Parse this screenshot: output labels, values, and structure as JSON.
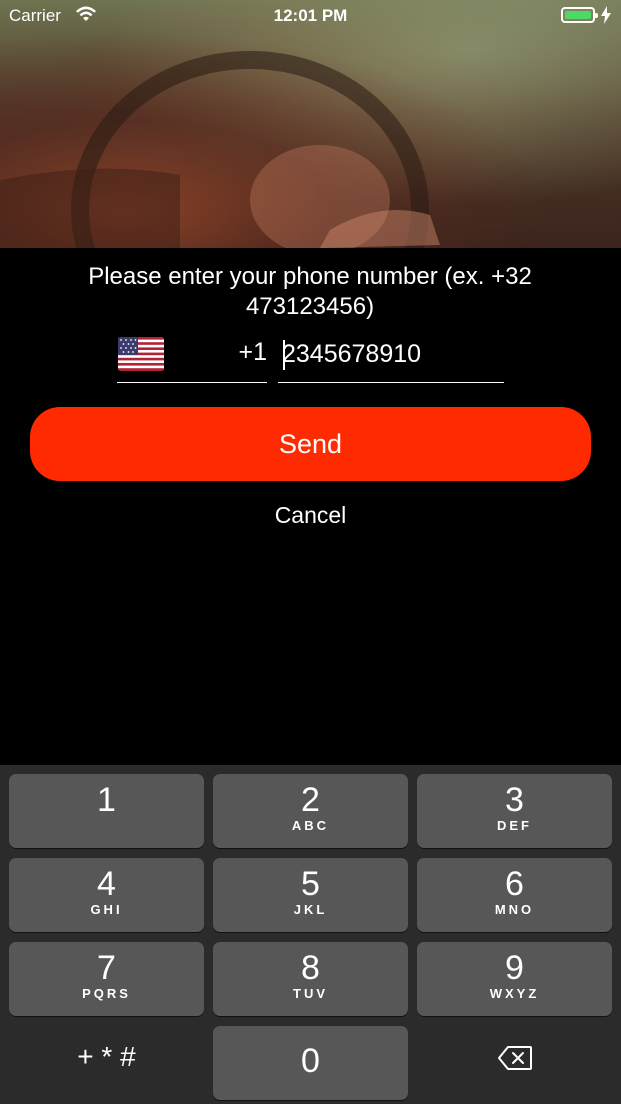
{
  "status_bar": {
    "carrier": "Carrier",
    "time": "12:01 PM"
  },
  "form": {
    "prompt": "Please enter your phone number (ex. +32 473123456)",
    "country_flag": "us-flag-icon",
    "dial_code": "+1",
    "phone_value": "2345678910",
    "send_label": "Send",
    "cancel_label": "Cancel"
  },
  "keypad": {
    "keys": [
      {
        "digit": "1",
        "letters": ""
      },
      {
        "digit": "2",
        "letters": "ABC"
      },
      {
        "digit": "3",
        "letters": "DEF"
      },
      {
        "digit": "4",
        "letters": "GHI"
      },
      {
        "digit": "5",
        "letters": "JKL"
      },
      {
        "digit": "6",
        "letters": "MNO"
      },
      {
        "digit": "7",
        "letters": "PQRS"
      },
      {
        "digit": "8",
        "letters": "TUV"
      },
      {
        "digit": "9",
        "letters": "WXYZ"
      },
      {
        "digit": "0",
        "letters": ""
      }
    ],
    "symbols_label": "+ * #",
    "delete_icon": "backspace-icon"
  },
  "colors": {
    "accent": "#ff2a00",
    "key_bg": "#575757",
    "keypad_bg": "#2b2b2b",
    "battery": "#4cd964"
  }
}
